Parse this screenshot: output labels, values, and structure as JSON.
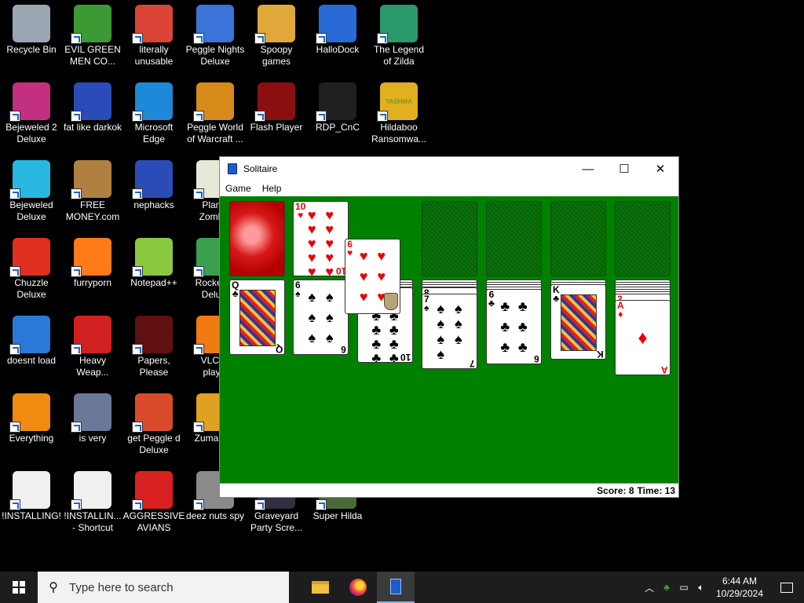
{
  "desktop": {
    "icons": [
      {
        "label": "Recycle Bin",
        "icon": "recycle-bin-icon",
        "color": "#9aa7b3"
      },
      {
        "label": "EVIL GREEN\nMEN CO...",
        "icon": "green-men-icon",
        "color": "#3c9a34"
      },
      {
        "label": "literally\nunusable",
        "icon": "chrome-icon",
        "color": "#db4437"
      },
      {
        "label": "Peggle Nights\nDeluxe",
        "icon": "peggle-icon",
        "color": "#3a74d8"
      },
      {
        "label": "Spoopy\ngames",
        "icon": "folder-icon",
        "color": "#e0a83a"
      },
      {
        "label": "HalloDock",
        "icon": "shield-icon",
        "color": "#2a6ad6"
      },
      {
        "label": "The Legend\nof Zilda",
        "icon": "zilda-icon",
        "color": "#2a9a6a"
      },
      {
        "label": "Bejeweled 2\nDeluxe",
        "icon": "bejeweled-2-icon",
        "color": "#c43080"
      },
      {
        "label": "fat like darkok",
        "icon": "mpi-icon",
        "color": "#2b4bb8"
      },
      {
        "label": "Microsoft\nEdge",
        "icon": "edge-icon",
        "color": "#1c8ad8"
      },
      {
        "label": "Peggle World\nof Warcraft ...",
        "icon": "peggle-wow-icon",
        "color": "#d88a1a"
      },
      {
        "label": "Flash Player",
        "icon": "flash-icon",
        "color": "#8a1010"
      },
      {
        "label": "RDP_CnC",
        "icon": "rdp-icon",
        "color": "#202020"
      },
      {
        "label": "Hildaboo\nRansomwa...",
        "icon": "yashma-icon",
        "color": "#e0b020",
        "logo_text": "YASHMA"
      },
      {
        "label": "Bejeweled\nDeluxe",
        "icon": "gem-icon",
        "color": "#28b8e0"
      },
      {
        "label": "FREE\nMONEY.com",
        "icon": "money-bag-icon",
        "color": "#b08040"
      },
      {
        "label": "nephacks",
        "icon": "mpi-icon",
        "color": "#2b4bb8"
      },
      {
        "label": "Plants\nZomb...",
        "icon": "flower-icon",
        "color": "#e8e8d8"
      },
      {
        "label": "Chuzzle\nDeluxe",
        "icon": "chuzzle-icon",
        "color": "#e03020"
      },
      {
        "label": "furryporn",
        "icon": "firefox-icon",
        "color": "#ff7a18"
      },
      {
        "label": "Notepad++",
        "icon": "notepad-plus-icon",
        "color": "#8ac840"
      },
      {
        "label": "Rocket M\nDelu...",
        "icon": "rocket-icon",
        "color": "#3aa050"
      },
      {
        "label": "doesnt load",
        "icon": "thunderbird-icon",
        "color": "#2a78d8"
      },
      {
        "label": "Heavy\nWeap...",
        "icon": "radiation-icon",
        "color": "#d02020"
      },
      {
        "label": "Papers, Please",
        "icon": "papers-please-icon",
        "color": "#601010"
      },
      {
        "label": "VLC m\nplay...",
        "icon": "vlc-icon",
        "color": "#f07a10"
      },
      {
        "label": "Everything",
        "icon": "everything-icon",
        "color": "#f08a10"
      },
      {
        "label": "is very",
        "icon": "mpi-shield-icon",
        "color": "#6a7898"
      },
      {
        "label": "get Peggle d\nDeluxe",
        "icon": "peggle-icon",
        "color": "#d84a2a"
      },
      {
        "label": "Zuma D...",
        "icon": "zuma-icon",
        "color": "#e0a020"
      },
      {
        "label": "!INSTALLING!",
        "icon": "document-icon",
        "color": "#f0f0f0"
      },
      {
        "label": "!INSTALLIN...\n- Shortcut",
        "icon": "document-icon",
        "color": "#f0f0f0"
      },
      {
        "label": "AGGRESSIVE\nAVIANS",
        "icon": "angry-bird-icon",
        "color": "#d82020"
      },
      {
        "label": "deez nuts spy",
        "icon": "stack-icon",
        "color": "#8a8a8a"
      },
      {
        "label": "Graveyard\nParty Scre...",
        "icon": "graveyard-icon",
        "color": "#303040"
      },
      {
        "label": "Super Hilda",
        "icon": "super-hilda-icon",
        "color": "#4a6a3a"
      }
    ]
  },
  "window": {
    "title": "Solitaire",
    "menu": [
      "Game",
      "Help"
    ],
    "controls": {
      "minimize": "—",
      "maximize": "☐",
      "close": "✕"
    },
    "status": {
      "score_label": "Score: 8",
      "time_label": "Time: 13"
    },
    "felt_color": "#008000",
    "cards": {
      "waste": {
        "rank": "10",
        "suit": "♥",
        "color": "red"
      },
      "dragged": {
        "rank": "6",
        "suit": "♥",
        "color": "red"
      },
      "tableau": [
        {
          "rank": "Q",
          "suit": "♣",
          "color": "black",
          "face": true
        },
        {
          "rank": "6",
          "suit": "♠",
          "color": "black"
        },
        {
          "rank": "10",
          "suit": "♣",
          "color": "black"
        },
        {
          "rank": "7",
          "suit": "♠",
          "color": "black",
          "under_rank": "8"
        },
        {
          "rank": "6",
          "suit": "♣",
          "color": "black"
        },
        {
          "rank": "K",
          "suit": "♣",
          "color": "black",
          "face": true
        },
        {
          "rank": "A",
          "suit": "♦",
          "color": "red",
          "under_rank": "2"
        }
      ]
    }
  },
  "taskbar": {
    "search_placeholder": "Type here to search",
    "apps": [
      {
        "name": "file-explorer-icon",
        "color": "#f0c040"
      },
      {
        "name": "firefox-icon",
        "color": "#ff7a18"
      },
      {
        "name": "solitaire-icon",
        "color": "#1e5cc8",
        "active": true
      }
    ],
    "clock": {
      "time": "6:44 AM",
      "date": "10/29/2024"
    }
  }
}
